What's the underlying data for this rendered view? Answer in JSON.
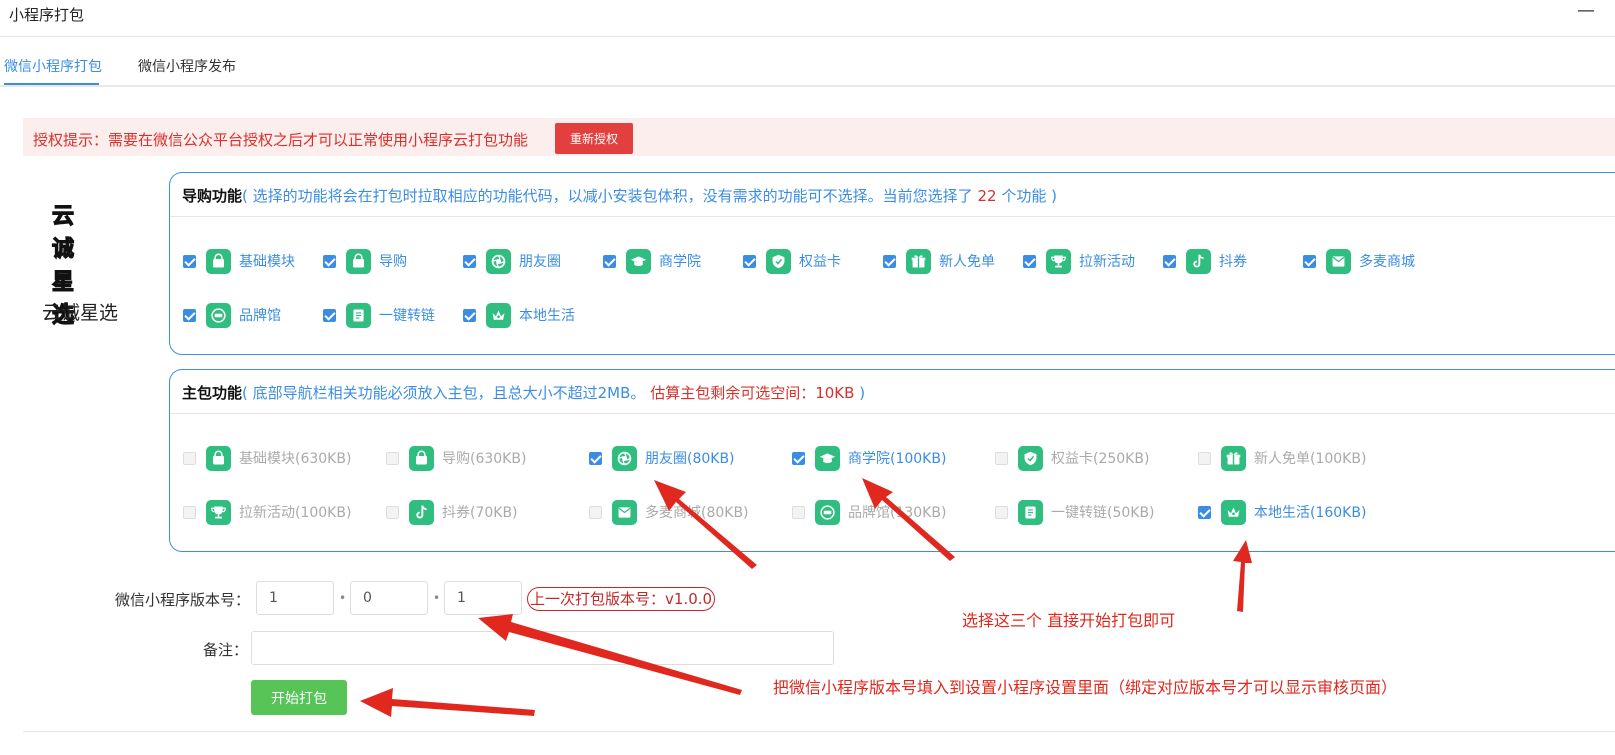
{
  "window": {
    "title": "小程序打包",
    "minimize_glyph": "—"
  },
  "tabs": [
    {
      "label": "微信小程序打包",
      "active": true
    },
    {
      "label": "微信小程序发布",
      "active": false
    }
  ],
  "alert": {
    "message": "授权提示：需要在微信公众平台授权之后才可以正常使用小程序云打包功能",
    "button": "重新授权"
  },
  "brand": {
    "logo_line1": "云 诚",
    "logo_line2": "星 选",
    "name": "云诚星选"
  },
  "guide_panel": {
    "title": "导购功能",
    "note_before": "( 选择的功能将会在打包时拉取相应的功能代码，以减小安装包体积，没有需求的功能可不选择。当前您选择了",
    "count": "22",
    "note_after": "个功能 )",
    "items": [
      {
        "label": "基础模块",
        "checked": true,
        "icon": "bag-icon"
      },
      {
        "label": "导购",
        "checked": true,
        "icon": "bag-icon"
      },
      {
        "label": "朋友圈",
        "checked": true,
        "icon": "aperture-icon"
      },
      {
        "label": "商学院",
        "checked": true,
        "icon": "graduation-cap-icon"
      },
      {
        "label": "权益卡",
        "checked": true,
        "icon": "shield-icon"
      },
      {
        "label": "新人免单",
        "checked": true,
        "icon": "gift-icon"
      },
      {
        "label": "拉新活动",
        "checked": true,
        "icon": "trophy-icon"
      },
      {
        "label": "抖券",
        "checked": true,
        "icon": "tiktok-icon"
      },
      {
        "label": "多麦商城",
        "checked": true,
        "icon": "mail-icon"
      },
      {
        "label": "品牌馆",
        "checked": true,
        "icon": "brand-badge-icon"
      },
      {
        "label": "一键转链",
        "checked": true,
        "icon": "document-icon"
      },
      {
        "label": "本地生活",
        "checked": true,
        "icon": "crown-icon"
      }
    ]
  },
  "main_panel": {
    "title": "主包功能",
    "note": "( 底部导航栏相关功能必须放入主包，且总大小不超过2MB。",
    "space_note": "估算主包剩余可选空间：10KB",
    "close_paren": ")",
    "items": [
      {
        "label": "基础模块(630KB)",
        "checked": false,
        "disabled": true,
        "icon": "bag-icon"
      },
      {
        "label": "导购(630KB)",
        "checked": false,
        "disabled": true,
        "icon": "bag-icon"
      },
      {
        "label": "朋友圈(80KB)",
        "checked": true,
        "disabled": false,
        "icon": "aperture-icon"
      },
      {
        "label": "商学院(100KB)",
        "checked": true,
        "disabled": false,
        "icon": "graduation-cap-icon"
      },
      {
        "label": "权益卡(250KB)",
        "checked": false,
        "disabled": true,
        "icon": "shield-icon"
      },
      {
        "label": "新人免单(100KB)",
        "checked": false,
        "disabled": true,
        "icon": "gift-icon"
      },
      {
        "label": "拉新活动(100KB)",
        "checked": false,
        "disabled": true,
        "icon": "trophy-icon"
      },
      {
        "label": "抖券(70KB)",
        "checked": false,
        "disabled": true,
        "icon": "tiktok-icon"
      },
      {
        "label": "多麦商城(80KB)",
        "checked": false,
        "disabled": true,
        "icon": "mail-icon"
      },
      {
        "label": "品牌馆(130KB)",
        "checked": false,
        "disabled": true,
        "icon": "brand-badge-icon"
      },
      {
        "label": "一键转链(50KB)",
        "checked": false,
        "disabled": true,
        "icon": "document-icon"
      },
      {
        "label": "本地生活(160KB)",
        "checked": true,
        "disabled": false,
        "icon": "crown-icon"
      }
    ]
  },
  "version": {
    "label": "微信小程序版本号：",
    "major": "1",
    "minor": "0",
    "patch": "1",
    "separator": "•",
    "last": "上一次打包版本号：v1.0.0"
  },
  "remark": {
    "label": "备注：",
    "value": ""
  },
  "start_button": "开始打包",
  "annotations": {
    "select_three": "选择这三个 直接开始打包即可",
    "fill_version": "把微信小程序版本号填入到设置小程序设置里面（绑定对应版本号才可以显示审核页面）"
  },
  "colors": {
    "accent": "#3b8de3",
    "danger": "#e33f3f",
    "success": "#56c456",
    "icon_bg": "#2fbd80",
    "annotation": "#e0281e"
  }
}
